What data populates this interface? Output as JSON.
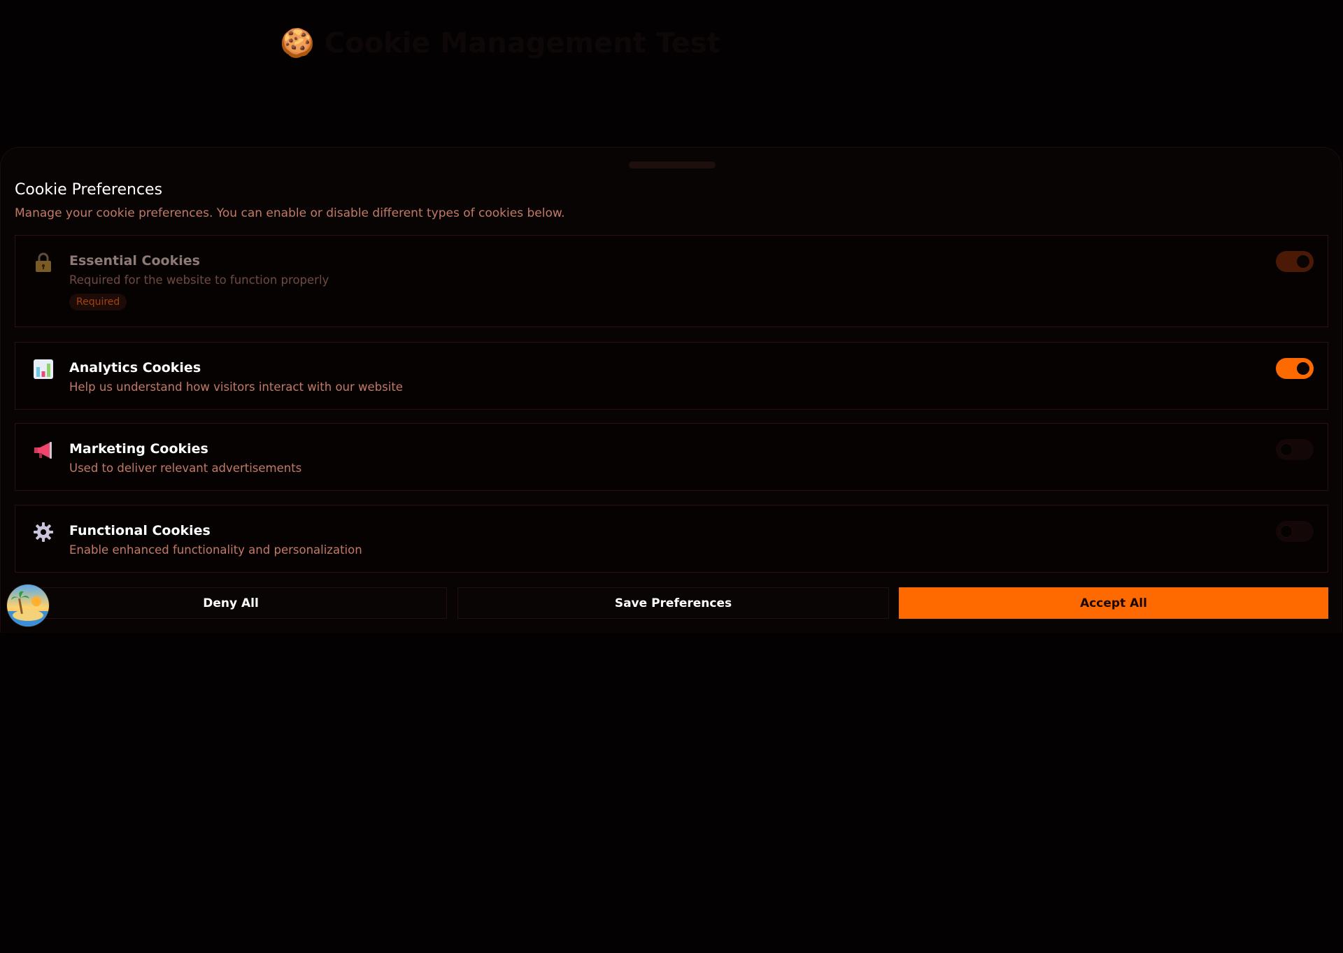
{
  "background": {
    "title": "🍪 Cookie Management Test",
    "subtitle": ""
  },
  "sheet": {
    "title": "Cookie Preferences",
    "description": "Manage your cookie preferences. You can enable or disable different types of cookies below."
  },
  "categories": [
    {
      "name": "Essential Cookies",
      "description": "Required for the website to function properly",
      "badge": "Required",
      "icon": "lock-icon",
      "enabled": true,
      "locked": true
    },
    {
      "name": "Analytics Cookies",
      "description": "Help us understand how visitors interact with our website",
      "icon": "bar-chart-icon",
      "enabled": true,
      "locked": false
    },
    {
      "name": "Marketing Cookies",
      "description": "Used to deliver relevant advertisements",
      "icon": "megaphone-icon",
      "enabled": false,
      "locked": false
    },
    {
      "name": "Functional Cookies",
      "description": "Enable enhanced functionality and personalization",
      "icon": "gear-icon",
      "enabled": false,
      "locked": false
    }
  ],
  "actions": {
    "deny_label": "Deny All",
    "save_label": "Save Preferences",
    "accept_label": "Accept All"
  },
  "colors": {
    "accent": "#ff6a00",
    "background": "#030101",
    "muted_text": "#c27a67"
  }
}
